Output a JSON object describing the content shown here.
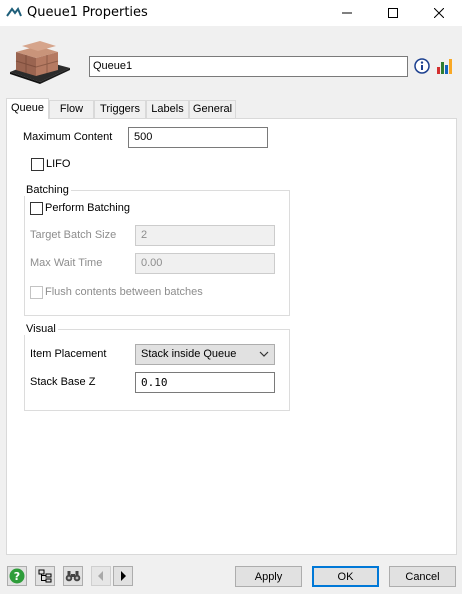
{
  "window": {
    "title": "Queue1  Properties",
    "controls": {
      "minimize": "minimize-icon",
      "maximize": "maximize-icon",
      "close": "close-icon"
    }
  },
  "header": {
    "object_name": "Queue1",
    "icons": [
      "info-icon",
      "statistics-icon"
    ]
  },
  "tabs": [
    {
      "label": "Queue",
      "active": true
    },
    {
      "label": "Flow"
    },
    {
      "label": "Triggers"
    },
    {
      "label": "Labels"
    },
    {
      "label": "General"
    }
  ],
  "queue_tab": {
    "max_content_label": "Maximum Content",
    "max_content_value": "500",
    "lifo_label": "LIFO",
    "lifo_checked": false,
    "batching": {
      "group_label": "Batching",
      "perform_label": "Perform Batching",
      "perform_checked": false,
      "target_batch_size_label": "Target Batch Size",
      "target_batch_size_value": "2",
      "max_wait_time_label": "Max Wait Time",
      "max_wait_time_value": "0.00",
      "flush_label": "Flush contents between batches"
    },
    "visual": {
      "group_label": "Visual",
      "item_placement_label": "Item Placement",
      "item_placement_value": "Stack inside Queue",
      "stack_base_z_label": "Stack Base Z",
      "stack_base_z_value": "0.10"
    }
  },
  "footer": {
    "icons": [
      "help-icon",
      "tree-icon",
      "binoculars-icon",
      "previous-icon",
      "next-icon"
    ],
    "apply_label": "Apply",
    "ok_label": "OK",
    "cancel_label": "Cancel"
  },
  "colors": {
    "accent": "#0078d7",
    "window_bg": "#f0f0f0",
    "page_bg": "#ffffff",
    "disabled_text": "#8d8d8d"
  }
}
